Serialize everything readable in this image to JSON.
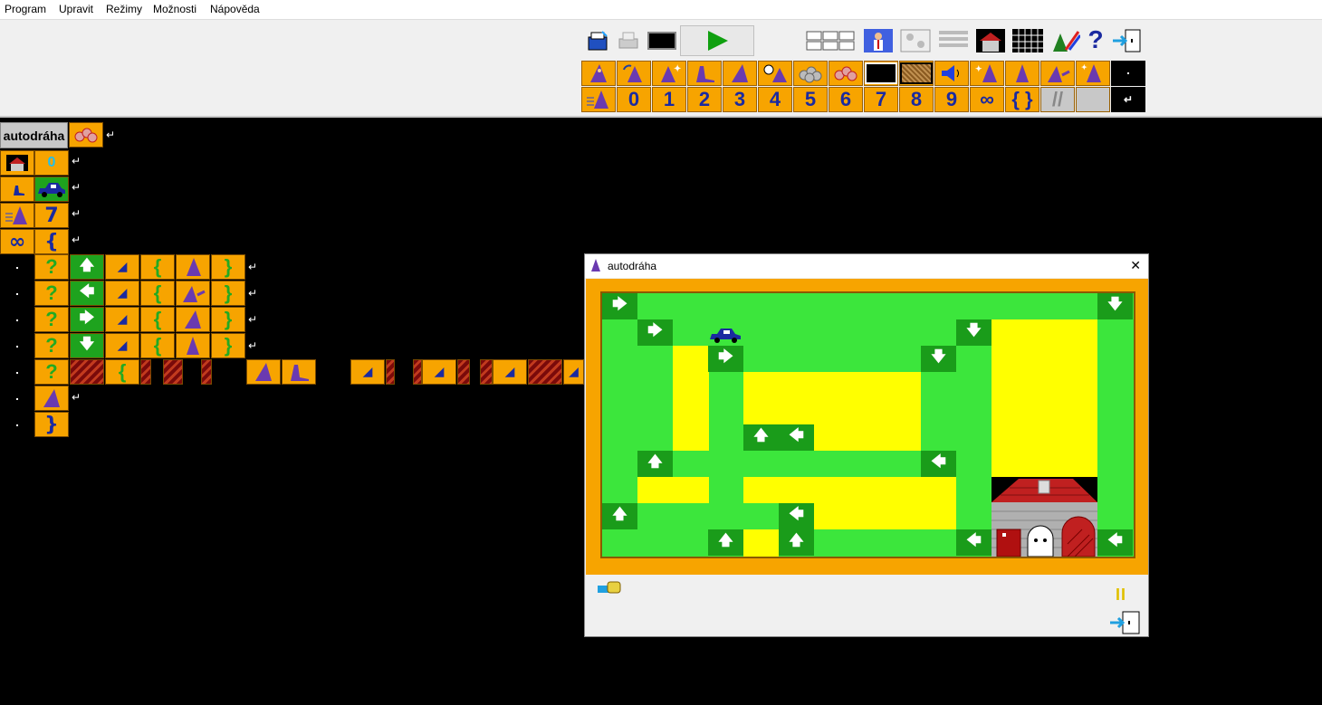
{
  "menu": {
    "items": [
      "Program",
      "Upravit",
      "Režimy",
      "Možnosti",
      "Nápověda"
    ]
  },
  "toolbar": {
    "help_glyph": "?",
    "icons": [
      "new-program-icon",
      "print-icon",
      "screen-icon",
      "run-icon",
      "layout-icon",
      "teacher-icon",
      "cards-icon",
      "list-icon",
      "house-icon",
      "grid-icon",
      "draw-icon",
      "help-icon",
      "exit-icon"
    ]
  },
  "palette": {
    "digits": [
      "0",
      "1",
      "2",
      "3",
      "4",
      "5",
      "6",
      "7",
      "8",
      "9"
    ],
    "infinity": "∞",
    "braces": "{ }",
    "comment": "//"
  },
  "editor": {
    "program_name": "autodráha",
    "row_repeat_count": "0",
    "row_speed_digit": "7",
    "row_loop_infinity": "∞",
    "row_loop_open": "{",
    "brace_open": "{",
    "brace_close": "}",
    "return_glyph": "↵",
    "if_glyph": "?",
    "if_label": "IF"
  },
  "window": {
    "title": "autodráha",
    "close_glyph": "✕",
    "pause_glyph": "II"
  },
  "colors": {
    "tile_orange": "#f7a400",
    "grass": "#3ce63c",
    "road_arrow": "#1a9c1a",
    "yellow": "#ffff00",
    "roof": "#c82020",
    "wall": "#b0b0b0"
  }
}
